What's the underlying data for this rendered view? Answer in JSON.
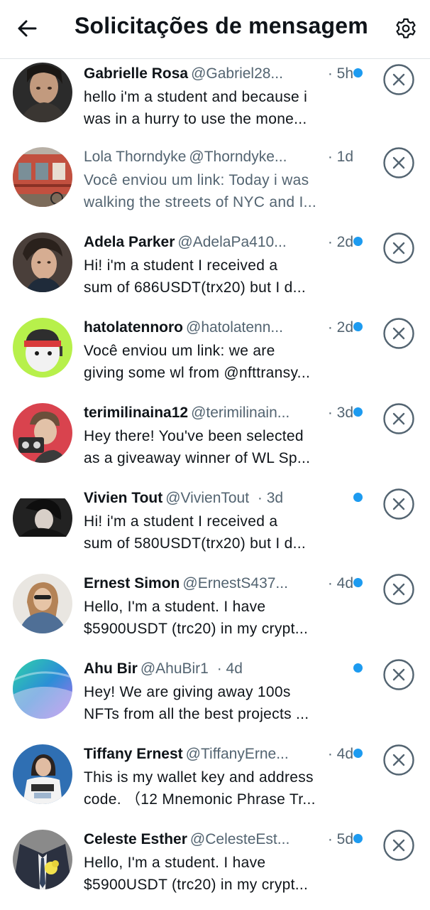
{
  "header": {
    "title": "Solicitações de mensagem",
    "back_icon": "arrow-left-icon",
    "settings_icon": "gear-icon"
  },
  "colors": {
    "accent": "#1d9bf0",
    "text_primary": "#0f1419",
    "text_secondary": "#536471",
    "divider": "#dfe3e6"
  },
  "requests": [
    {
      "name": "Gabrielle Rosa",
      "handle": "@Gabriel28...",
      "time": "· 5h",
      "line1": "hello i'm a student and because i",
      "line2": "was in a hurry to use the mone...",
      "unread": true
    },
    {
      "name": "Lola Thorndyke",
      "handle": "@Thorndyke...",
      "time": "· 1d",
      "line1": "Você enviou um link: Today i was",
      "line2": "walking the streets of NYC and I...",
      "unread": false
    },
    {
      "name": "Adela Parker",
      "handle": "@AdelaPa410...",
      "time": "· 2d",
      "line1": "Hi!  i'm a student  I received a",
      "line2": "sum of 686USDT(trx20) but I d...",
      "unread": true
    },
    {
      "name": "hatolatennoro",
      "handle": "@hatolatenn...",
      "time": "· 2d",
      "line1": "Você enviou um link: we are",
      "line2": "giving some wl from @nfttransy...",
      "unread": true
    },
    {
      "name": "terimilinaina12",
      "handle": "@terimilinain...",
      "time": "· 3d",
      "line1": "Hey there! You've been selected",
      "line2": "as a giveaway winner of WL Sp...",
      "unread": true
    },
    {
      "name": "Vivien Tout",
      "handle": "@VivienTout",
      "time": "· 3d",
      "line1": "Hi!  i'm a student  I received a",
      "line2": "sum of 580USDT(trx20) but I d...",
      "unread": true
    },
    {
      "name": "Ernest Simon",
      "handle": "@ErnestS437...",
      "time": "· 4d",
      "line1": "Hello, I'm a student. I have",
      "line2": "$5900USDT (trc20) in my crypt...",
      "unread": true
    },
    {
      "name": "Ahu Bir",
      "handle": "@AhuBir1",
      "time": "· 4d",
      "line1": "Hey! We are giving away 100s",
      "line2": "NFTs from all the best projects ...",
      "unread": true
    },
    {
      "name": "Tiffany Ernest",
      "handle": "@TiffanyErne...",
      "time": "· 4d",
      "line1": "This is my wallet key and address",
      "line2": "code. （12 Mnemonic Phrase Tr...",
      "unread": true
    },
    {
      "name": "Celeste Esther",
      "handle": "@CelesteEst...",
      "time": "· 5d",
      "line1": "Hello, I'm a student. I have",
      "line2": "$5900USDT (trc20) in my crypt...",
      "unread": true
    }
  ]
}
